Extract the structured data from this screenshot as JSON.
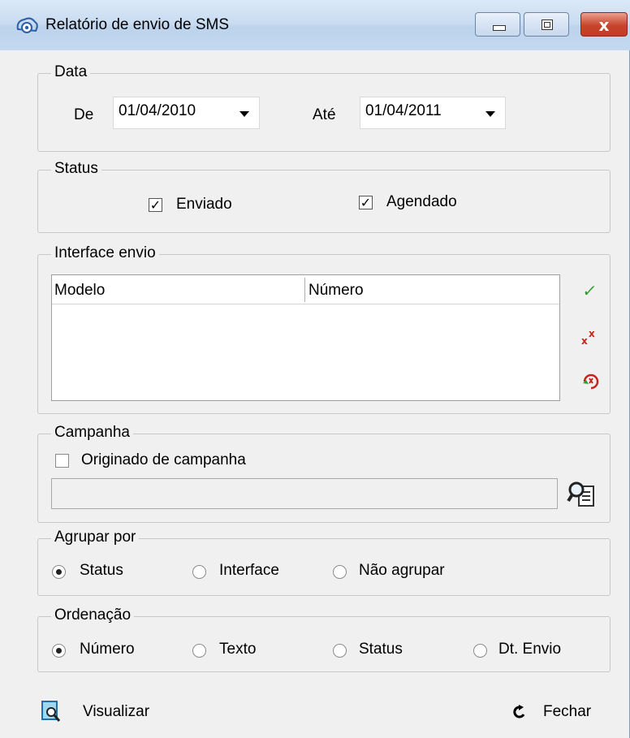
{
  "window": {
    "title": "Relatório de envio de SMS",
    "close_label": "x"
  },
  "data_group": {
    "legend": "Data",
    "from_label": "De",
    "from_value": "01/04/2010",
    "to_label": "Até",
    "to_value": "01/04/2011"
  },
  "status_group": {
    "legend": "Status",
    "enviado": {
      "label": "Enviado",
      "checked": true
    },
    "agendado": {
      "label": "Agendado",
      "checked": true
    }
  },
  "interface_group": {
    "legend": "Interface envio",
    "columns": [
      "Modelo",
      "Número"
    ],
    "rows": [],
    "icons": [
      "check-all-icon",
      "uncheck-all-icon",
      "refresh-icon"
    ]
  },
  "campanha_group": {
    "legend": "Campanha",
    "checkbox_label": "Originado de campanha",
    "checked": false,
    "field_value": "",
    "search_icon": "search-document-icon"
  },
  "agrupar_group": {
    "legend": "Agrupar por",
    "options": [
      "Status",
      "Interface",
      "Não agrupar"
    ],
    "selected": "Status"
  },
  "ordenacao_group": {
    "legend": "Ordenação",
    "options": [
      "Número",
      "Texto",
      "Status",
      "Dt. Envio"
    ],
    "selected": "Número"
  },
  "footer": {
    "preview_label": "Visualizar",
    "close_label": "Fechar"
  },
  "colors": {
    "check_green": "#2e9c2e",
    "cross_red": "#c8241a",
    "title_blue": "#c4d9f0"
  }
}
